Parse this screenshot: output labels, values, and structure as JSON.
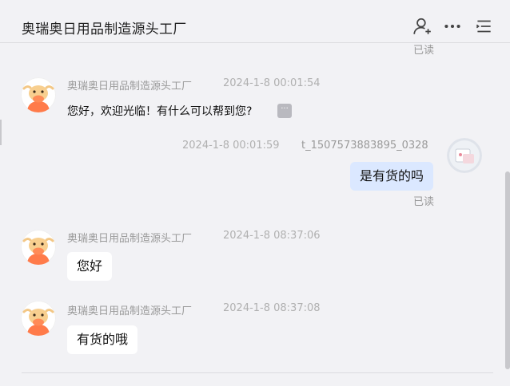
{
  "header": {
    "title": "奥瑞奥日用品制造源头工厂",
    "icons": [
      "add-contact-icon",
      "more-dots-icon",
      "list-menu-icon"
    ]
  },
  "messages": [
    {
      "read_label": "已读"
    },
    {
      "sender": "奥瑞奥日用品制造源头工厂",
      "time": "2024-1-8 00:01:54",
      "text": "您好，欢迎光临！有什么可以帮到您?",
      "more_label": "···"
    },
    {
      "sender": "t_1507573883895_0328",
      "time": "2024-1-8 00:01:59",
      "text": "是有货的吗",
      "read_label": "已读"
    },
    {
      "sender": "奥瑞奥日用品制造源头工厂",
      "time": "2024-1-8 08:37:06",
      "text": "您好"
    },
    {
      "sender": "奥瑞奥日用品制造源头工厂",
      "time": "2024-1-8 08:37:08",
      "text": "有货的哦"
    }
  ],
  "colors": {
    "background": "#f2f2f5",
    "self_bubble": "#dbe8ff",
    "other_bubble": "#ffffff",
    "meta_text": "#9a9a9a"
  }
}
